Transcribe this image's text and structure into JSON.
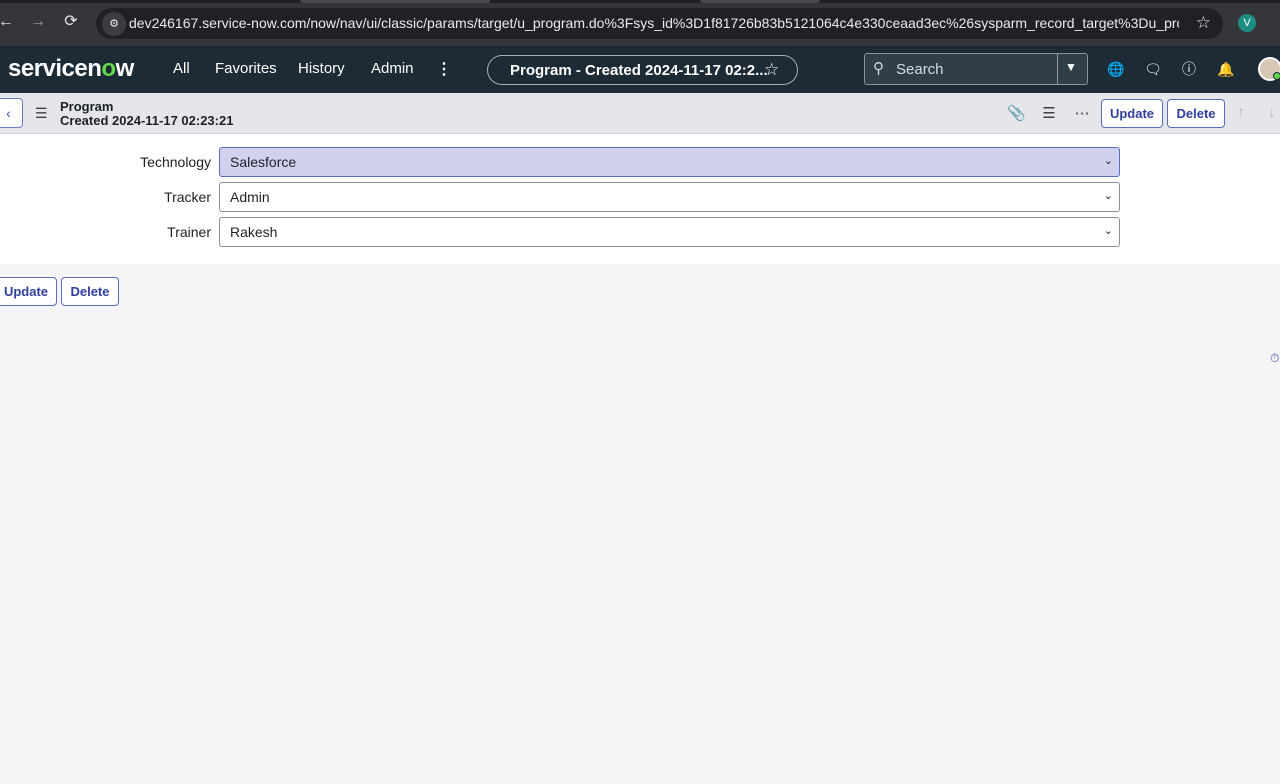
{
  "browser": {
    "url": "dev246167.service-now.com/now/nav/ui/classic/params/target/u_program.do%3Fsys_id%3D1f81726b83b5121064c4e330ceaad3ec%26sysparm_record_target%3Du_progr...",
    "profile_initial": "V",
    "icons": {
      "back": "back-arrow-icon",
      "forward": "forward-arrow-icon",
      "reload": "reload-icon",
      "site_info": "site-settings-icon",
      "bookmark": "star-icon"
    }
  },
  "header": {
    "logo_pre": "servicen",
    "logo_o": "o",
    "logo_post": "w",
    "menu": {
      "all": "All",
      "favorites": "Favorites",
      "history": "History",
      "admin": "Admin"
    },
    "context_title": "Program - Created 2024-11-17 02:2...",
    "search_placeholder": "Search",
    "brand_colors": {
      "header_bg": "#1d2b36",
      "logo_accent": "#62d84e",
      "primary": "#2f3e9e"
    }
  },
  "form": {
    "record_type": "Program",
    "record_name": "Created 2024-11-17 02:23:21",
    "buttons": {
      "update": "Update",
      "delete": "Delete"
    },
    "fields": [
      {
        "label": "Technology",
        "value": "Salesforce"
      },
      {
        "label": "Tracker",
        "value": "Admin"
      },
      {
        "label": "Trainer",
        "value": "Rakesh"
      }
    ],
    "bottom_buttons": {
      "update": "Update",
      "delete": "Delete"
    }
  }
}
